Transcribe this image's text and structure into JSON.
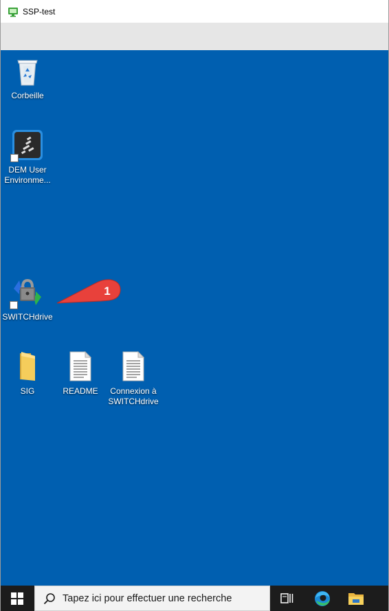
{
  "window": {
    "title": "SSP-test"
  },
  "desktop": {
    "icons": [
      {
        "name": "recycle-bin",
        "label": "Corbeille"
      },
      {
        "name": "dem-user",
        "label": "DEM User\nEnvironme..."
      },
      {
        "name": "switchdrive",
        "label": "SWITCHdrive"
      },
      {
        "name": "sig-folder",
        "label": "SIG"
      },
      {
        "name": "readme",
        "label": "README"
      },
      {
        "name": "connexion",
        "label": "Connexion à\nSWITCHdrive"
      }
    ],
    "callout_number": "1"
  },
  "taskbar": {
    "search_placeholder": "Tapez ici pour effectuer une recherche"
  },
  "colors": {
    "desktop_bg": "#005fb0",
    "callout_red": "#e8413b",
    "taskbar_bg": "#1c1c1c"
  },
  "icons": [
    "windows-start-icon",
    "search-icon",
    "task-view-icon",
    "edge-icon",
    "file-explorer-icon",
    "recycle-bin-icon",
    "dem-icon",
    "switchdrive-icon",
    "folder-icon",
    "document-icon"
  ]
}
